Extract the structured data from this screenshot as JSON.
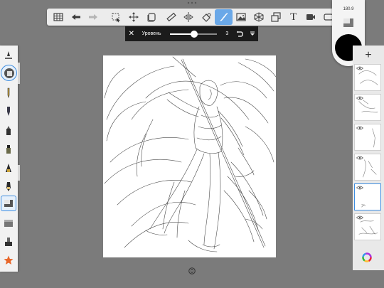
{
  "toolbar": {
    "icons": [
      "gallery-icon",
      "undo-icon",
      "redo-icon",
      "selection-icon",
      "transform-icon",
      "layers-icon",
      "ruler-icon",
      "symmetry-icon",
      "fill-icon",
      "curve-icon",
      "import-image-icon",
      "perspective-icon",
      "paste-icon",
      "text-icon",
      "video-icon",
      "frame-icon"
    ],
    "text_tool_glyph": "T"
  },
  "level_bar": {
    "close_glyph": "✕",
    "label": "Уровень",
    "value": "3",
    "fraction": 0.52
  },
  "color": {
    "readout": "180.9",
    "current": "#000000"
  },
  "layers": {
    "add_glyph": "+",
    "count": 7,
    "active_index": 4
  },
  "colors": {
    "accent": "#3d8de0",
    "background": "#7b7b7b",
    "toolbar": "#ececec"
  }
}
